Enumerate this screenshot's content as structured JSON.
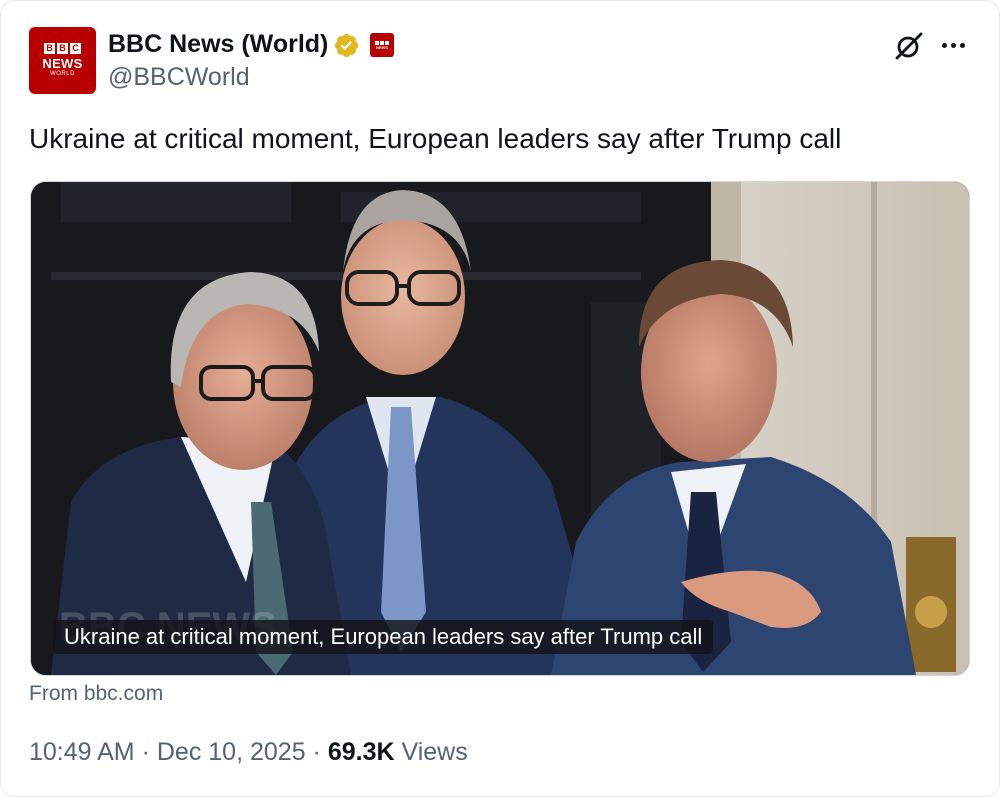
{
  "account": {
    "display_name": "BBC News (World)",
    "handle": "@BBCWorld",
    "avatar_logo": "BBC",
    "avatar_text": "NEWS",
    "avatar_sub": "WORLD",
    "verified_icon": "gold-check-badge",
    "affiliation_icon": "bbc-news-badge"
  },
  "header_actions": {
    "grok_icon": "grok-icon",
    "more_icon": "more-dots-icon"
  },
  "tweet": {
    "text": "Ukraine at critical moment, European leaders say after Trump call"
  },
  "card": {
    "caption": "Ukraine at critical moment, European leaders say after Trump call",
    "source": "From bbc.com"
  },
  "meta": {
    "time": "10:49 AM",
    "date": "Dec 10, 2025",
    "separator": "·",
    "views_count": "69.3K",
    "views_label": "Views"
  },
  "colors": {
    "bbc_red": "#b80000",
    "verified_gold": "#e2b719",
    "secondary_text": "#536471"
  }
}
